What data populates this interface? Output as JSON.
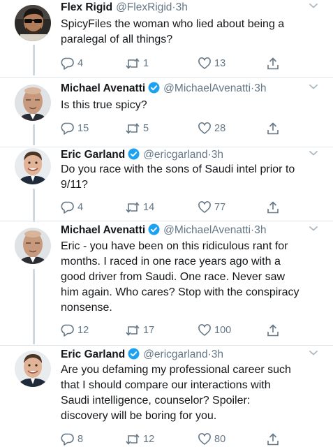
{
  "colors": {
    "text": "#14171a",
    "secondary": "#657786",
    "verified": "#1da1f2",
    "thread_line": "#cfd9de",
    "divider": "#e1e8ed"
  },
  "tweets": [
    {
      "name": "Flex Rigid",
      "handle": "@FlexRigid",
      "dot": "·",
      "time": "3h",
      "verified": false,
      "text": "SpicyFiles the woman who lied about being a\nparalegal of all things?",
      "replies": "4",
      "retweets": "1",
      "likes": "13"
    },
    {
      "name": "Michael Avenatti",
      "handle": "@MichaelAvenatti",
      "dot": "·",
      "time": "3h",
      "verified": true,
      "text": "Is this true spicy?",
      "replies": "15",
      "retweets": "5",
      "likes": "28"
    },
    {
      "name": "Eric Garland",
      "handle": "@ericgarland",
      "dot": "·",
      "time": "3h",
      "verified": true,
      "text": "Do you race with the sons of Saudi intel prior to\n9/11?",
      "replies": "4",
      "retweets": "14",
      "likes": "77"
    },
    {
      "name": "Michael Avenatti",
      "handle": "@MichaelAvenatti",
      "dot": "·",
      "time": "3h",
      "verified": true,
      "text": "Eric - you have been on this ridiculous rant for\nmonths. I raced in one race years ago with a\ngood driver from Saudi. One race. Never saw\nhim again. Who cares? Stop with the conspiracy\nnonsense.",
      "replies": "12",
      "retweets": "17",
      "likes": "100"
    },
    {
      "name": "Eric Garland",
      "handle": "@ericgarland",
      "dot": "·",
      "time": "3h",
      "verified": true,
      "text": "Are you defaming my professional career such\nthat I should compare our interactions with\nSaudi intelligence, counselor? Spoiler:\ndiscovery will be boring for you.",
      "replies": "8",
      "retweets": "12",
      "likes": "80"
    }
  ],
  "icons": {
    "reply": "reply-icon",
    "retweet": "retweet-icon",
    "like": "heart-icon",
    "share": "share-icon",
    "caret": "chevron-down-icon",
    "verified": "verified-badge-icon"
  }
}
